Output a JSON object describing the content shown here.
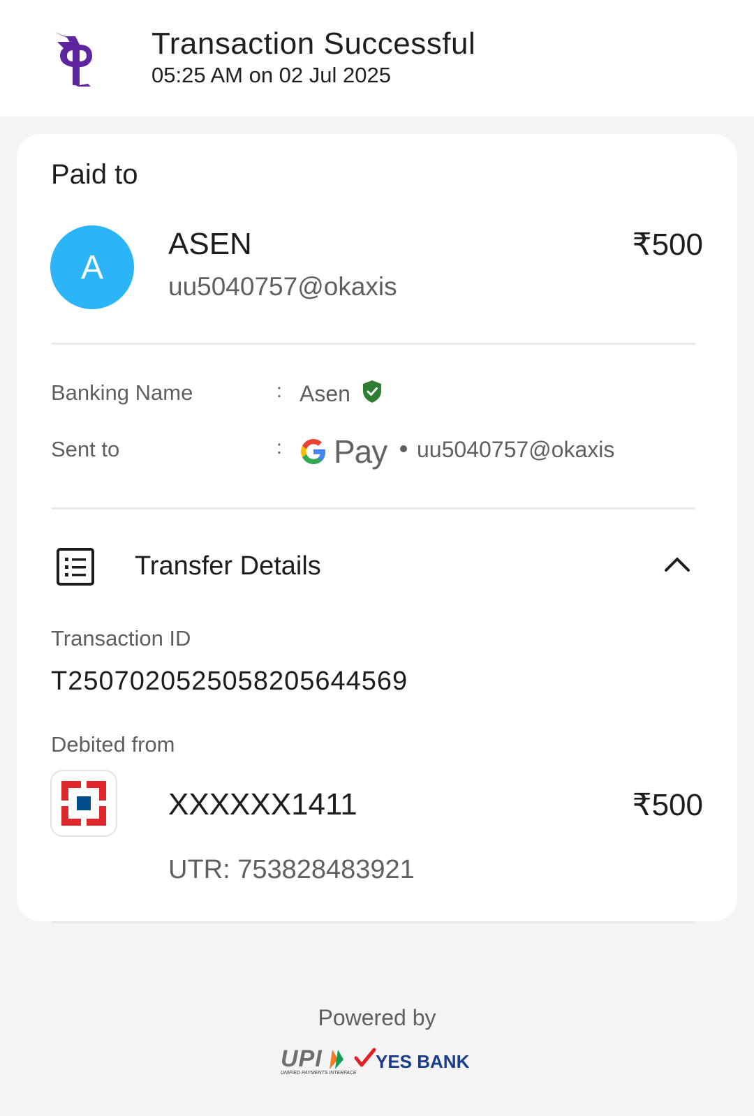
{
  "header": {
    "logo_icon": "phonepe-logo-icon",
    "title": "Transaction Successful",
    "datetime": "05:25 AM on 02 Jul 2025"
  },
  "paid_to": {
    "section_title": "Paid to",
    "avatar_initial": "A",
    "avatar_color": "#2CB5F6",
    "name": "ASEN",
    "upi_id": "uu5040757@okaxis",
    "amount": "₹500"
  },
  "details": {
    "banking_name_label": "Banking Name",
    "banking_name_value": "Asen",
    "verified_icon": "verified-shield-icon",
    "sent_to_label": "Sent to",
    "sent_to_app": "Pay",
    "sent_to_upi": "uu5040757@okaxis",
    "colon": ":"
  },
  "transfer": {
    "icon": "receipt-list-icon",
    "title": "Transfer Details",
    "toggle_icon": "chevron-up-icon",
    "transaction_id_label": "Transaction ID",
    "transaction_id": "T2507020525058205644569",
    "debited_from_label": "Debited from",
    "bank_icon": "hdfc-bank-logo-icon",
    "account_number": "XXXXXX1411",
    "amount": "₹500",
    "utr": "UTR: 753828483921"
  },
  "footer": {
    "powered_by": "Powered by",
    "upi_brand": "UPI",
    "upi_tagline": "UNIFIED PAYMENTS INTERFACE",
    "bank_brand": "YES BANK"
  },
  "colors": {
    "brand_purple": "#5F259F",
    "verified_green": "#2E7D32",
    "hdfc_red": "#E0272B",
    "hdfc_blue": "#004C8F",
    "yes_bank_blue": "#1A3C8E",
    "yes_bank_red": "#E31E24"
  }
}
